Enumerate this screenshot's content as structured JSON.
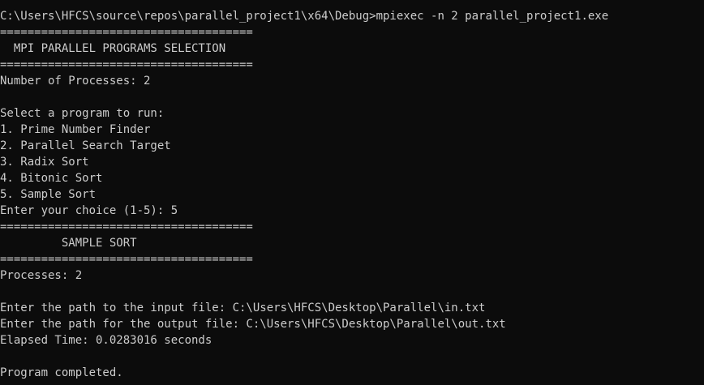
{
  "window": {
    "background": "#0c0c0c",
    "foreground": "#cccccc"
  },
  "console": {
    "lines": [
      "C:\\Users\\HFCS\\source\\repos\\parallel_project1\\x64\\Debug>mpiexec -n 2 parallel_project1.exe",
      "=====================================",
      "  MPI PARALLEL PROGRAMS SELECTION",
      "=====================================",
      "Number of Processes: 2",
      "",
      "Select a program to run:",
      "1. Prime Number Finder",
      "2. Parallel Search Target",
      "3. Radix Sort",
      "4. Bitonic Sort",
      "5. Sample Sort",
      "Enter your choice (1-5): 5",
      "=====================================",
      "         SAMPLE SORT",
      "=====================================",
      "Processes: 2",
      "",
      "Enter the path to the input file: C:\\Users\\HFCS\\Desktop\\Parallel\\in.txt",
      "Enter the path for the output file: C:\\Users\\HFCS\\Desktop\\Parallel\\out.txt",
      "Elapsed Time: 0.0283016 seconds",
      "",
      "Program completed."
    ]
  }
}
